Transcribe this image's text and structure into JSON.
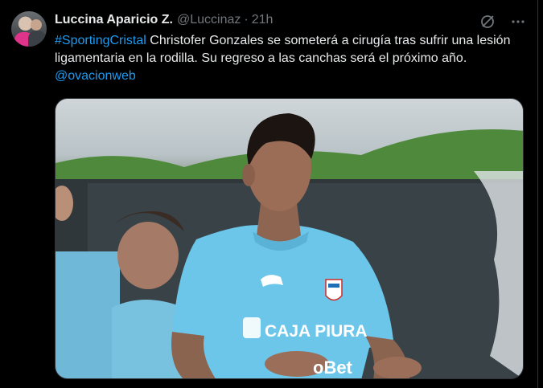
{
  "tweet": {
    "author_name": "Luccina Aparicio Z.",
    "author_handle": "@Luccinaz",
    "separator": "·",
    "time": "21h",
    "text_parts": {
      "hashtag": "#SportingCristal",
      "body": " Christofer Gonzales se someterá a cirugía tras sufrir una lesión ligamentaria en la rodilla. Su regreso a las canchas será el próximo año. ",
      "mention": "@ovacionweb"
    },
    "icons": {
      "grok": "grok-icon",
      "more": "more-icon"
    },
    "media": {
      "shirt_sponsor": "CAJA PIURA",
      "shirt_sponsor2": "oBet",
      "shirt_brand": "puma-logo"
    }
  },
  "colors": {
    "background": "#000000",
    "text": "#e7e9ea",
    "secondary": "#71767b",
    "link": "#1d9bf0",
    "jersey": "#6cc6ea"
  }
}
